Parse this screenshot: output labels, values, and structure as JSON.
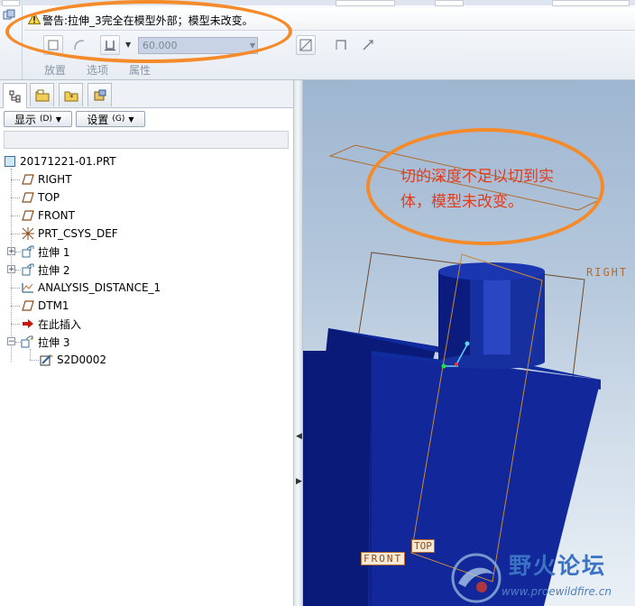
{
  "dashboard": {
    "warning_text": "警告:拉伸_3完全在模型外部；模型未改变。",
    "depth_value": "60.000",
    "tabs": [
      "放置",
      "选项",
      "属性"
    ]
  },
  "panel": {
    "display_button": "显示",
    "display_key": "(D)",
    "settings_button": "设置",
    "settings_key": "(G)"
  },
  "tree": {
    "root": "20171221-01.PRT",
    "items": [
      {
        "label": "RIGHT",
        "icon": "datum-plane-icon"
      },
      {
        "label": "TOP",
        "icon": "datum-plane-icon"
      },
      {
        "label": "FRONT",
        "icon": "datum-plane-icon"
      },
      {
        "label": "PRT_CSYS_DEF",
        "icon": "csys-icon"
      },
      {
        "label": "拉伸 1",
        "icon": "extrude-icon"
      },
      {
        "label": "拉伸 2",
        "icon": "extrude-icon"
      },
      {
        "label": "ANALYSIS_DISTANCE_1",
        "icon": "analysis-icon"
      },
      {
        "label": "DTM1",
        "icon": "datum-plane-icon"
      },
      {
        "label": "在此插入",
        "icon": "insert-here-arrow-icon"
      },
      {
        "label": "拉伸 3",
        "icon": "extrude-icon"
      },
      {
        "label": "S2D0002",
        "icon": "sketch-icon"
      }
    ]
  },
  "viewport": {
    "note": "切的深度不足以切到实体，模型未改变。",
    "plane_right": "RIGHT",
    "plane_top": "TOP",
    "plane_front": "FRONT",
    "watermark_title": "野火论坛",
    "watermark_url": "www.proewildfire.cn"
  },
  "colors": {
    "annotation": "#f58a2a",
    "note_text": "#e23b1d",
    "model": "#0b1f8c",
    "datum": "#b36b2d"
  }
}
